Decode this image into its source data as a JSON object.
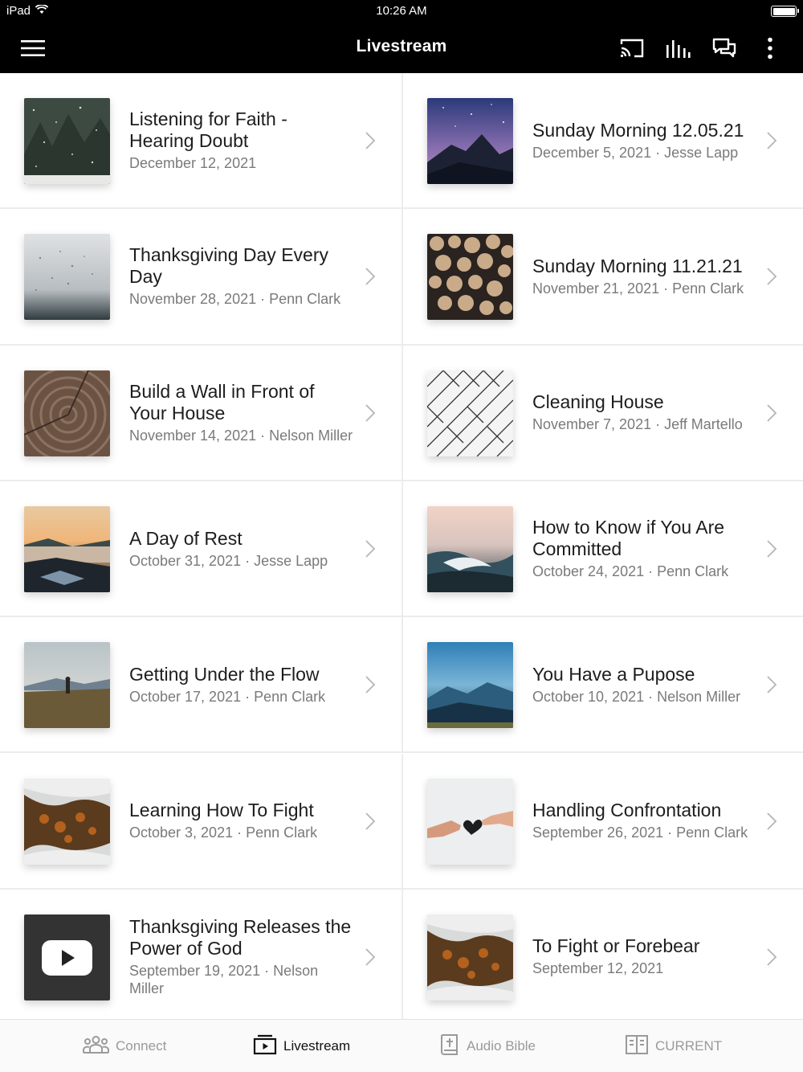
{
  "status": {
    "device": "iPad",
    "time": "10:26 AM"
  },
  "nav": {
    "title": "Livestream",
    "icons": [
      "menu-icon",
      "cast-icon",
      "audio-bars-icon",
      "chat-icon",
      "more-vertical-icon"
    ]
  },
  "items": [
    {
      "title": "Listening for Faith - Hearing Doubt",
      "meta": "December 12, 2021",
      "thumb": "snowy-forest"
    },
    {
      "title": "Sunday Morning 12.05.21",
      "meta": "December 5, 2021 · Jesse Lapp",
      "thumb": "milky-way-mountain"
    },
    {
      "title": "Thanksgiving Day Every Day",
      "meta": "November 28, 2021 · Penn Clark",
      "thumb": "rain-window"
    },
    {
      "title": "Sunday Morning 11.21.21",
      "meta": "November 21, 2021 · Penn Clark",
      "thumb": "stacked-logs"
    },
    {
      "title": "Build a Wall in Front of Your House",
      "meta": "November 14, 2021 · Nelson Miller",
      "thumb": "tree-rings"
    },
    {
      "title": "Cleaning House",
      "meta": "November 7, 2021 · Jeff Martello",
      "thumb": "herringbone-tile"
    },
    {
      "title": "A Day of Rest",
      "meta": "October 31, 2021 · Jesse Lapp",
      "thumb": "lake-sunset"
    },
    {
      "title": "How to Know if You Are Committed",
      "meta": "October 24, 2021 · Penn Clark",
      "thumb": "ocean-wave"
    },
    {
      "title": "Getting Under the Flow",
      "meta": "October 17, 2021 · Penn Clark",
      "thumb": "hiker-field"
    },
    {
      "title": "You Have a Pupose",
      "meta": "October 10, 2021 · Nelson Miller",
      "thumb": "blue-mountains"
    },
    {
      "title": "Learning How To Fight",
      "meta": "October 3, 2021 · Penn Clark",
      "thumb": "autumn-mist"
    },
    {
      "title": "Handling Confrontation",
      "meta": "September 26, 2021 · Penn Clark",
      "thumb": "hands-heart"
    },
    {
      "title": "Thanksgiving Releases the Power of God",
      "meta": "September 19, 2021 · Nelson Miller",
      "thumb": "youtube-placeholder"
    },
    {
      "title": "To Fight or Forebear",
      "meta": "September 12, 2021",
      "thumb": "autumn-mist"
    }
  ],
  "tabs": [
    {
      "label": "Connect",
      "icon": "people-icon",
      "active": false
    },
    {
      "label": "Livestream",
      "icon": "livestream-icon",
      "active": true
    },
    {
      "label": "Audio Bible",
      "icon": "bible-icon",
      "active": false
    },
    {
      "label": "CURRENT",
      "icon": "book-open-icon",
      "active": false
    }
  ],
  "colors": {
    "bar": "#000000",
    "active_tab": "#111111",
    "inactive_tab": "#9a9a9a",
    "meta": "#7a7a7a"
  }
}
